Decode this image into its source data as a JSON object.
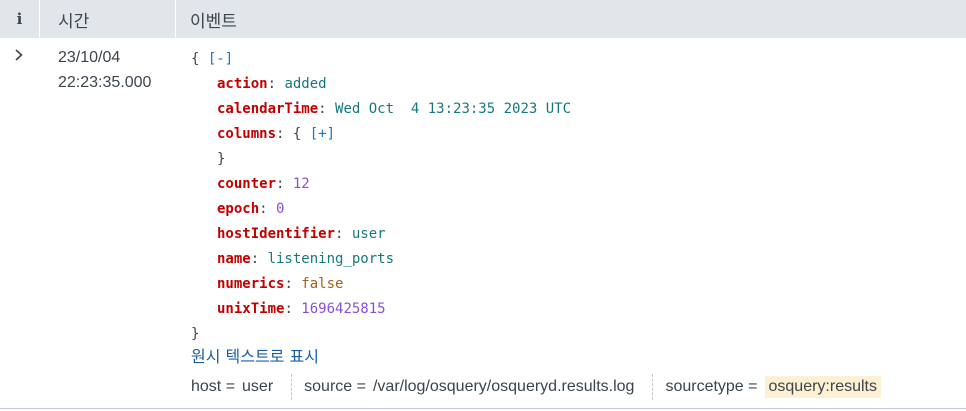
{
  "header": {
    "info_label": "i",
    "time_label": "시간",
    "event_label": "이벤트"
  },
  "row": {
    "expander_icon": "chevron-right-icon",
    "date": "23/10/04",
    "time": "22:23:35.000",
    "json": {
      "open_brace": "{",
      "collapse_toggle": "[-]",
      "close_brace": "}",
      "fields": [
        {
          "key": "action",
          "value": "added",
          "type": "str"
        },
        {
          "key": "calendarTime",
          "value": "Wed Oct  4 13:23:35 2023 UTC",
          "type": "str"
        },
        {
          "key": "columns",
          "value": "{",
          "toggle": "[+]",
          "close": "}",
          "type": "obj"
        },
        {
          "key": "counter",
          "value": "12",
          "type": "num"
        },
        {
          "key": "epoch",
          "value": "0",
          "type": "num"
        },
        {
          "key": "hostIdentifier",
          "value": "user",
          "type": "str"
        },
        {
          "key": "name",
          "value": "listening_ports",
          "type": "str"
        },
        {
          "key": "numerics",
          "value": "false",
          "type": "bool"
        },
        {
          "key": "unixTime",
          "value": "1696425815",
          "type": "num"
        }
      ]
    },
    "raw_text_link": "원시 텍스트로 표시",
    "meta_fields": [
      {
        "name": "host =",
        "value": "user",
        "highlight": false
      },
      {
        "name": "source =",
        "value": "/var/log/osquery/osqueryd.results.log",
        "highlight": false
      },
      {
        "name": "sourcetype =",
        "value": "osquery:results",
        "highlight": true
      }
    ]
  },
  "colors": {
    "header_bg": "#e1e6eb",
    "key": "#c20000",
    "string": "#16787e",
    "number": "#8b4fd6",
    "boolean": "#a0621e",
    "link": "#1a5fa6",
    "highlight": "#fdf0d3"
  }
}
